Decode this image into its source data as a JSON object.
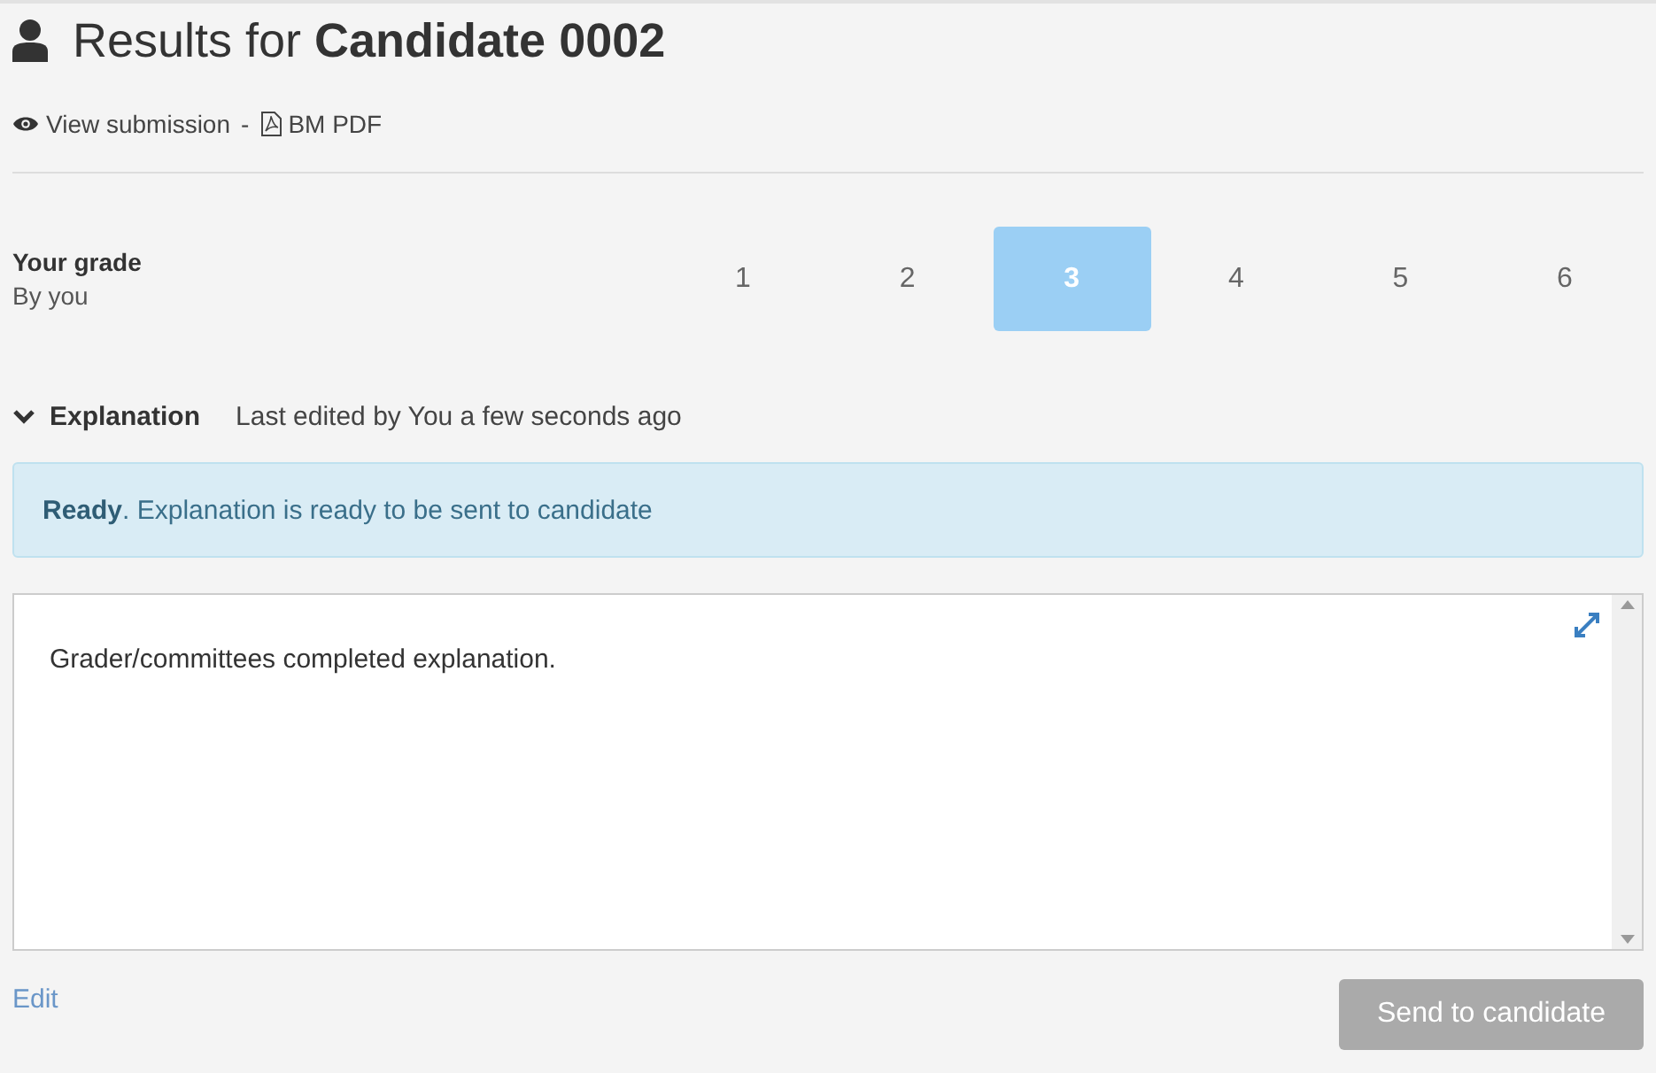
{
  "header": {
    "title": "Results for **Candidate 0002**"
  },
  "links": [
    {
      "label": "View submission",
      "kind": "view"
    },
    {
      "label": "-",
      "kind": "separator"
    },
    {
      "label": "BM PDF",
      "kind": "pdf"
    }
  ],
  "grade": {
    "label": "Your grade",
    "sublabel": "By you",
    "options": [
      {
        "label": "1",
        "selected": false
      },
      {
        "label": "2",
        "selected": false
      },
      {
        "label": "3",
        "selected": true
      },
      {
        "label": "4",
        "selected": false
      },
      {
        "label": "5",
        "selected": false
      },
      {
        "label": "6",
        "selected": false
      }
    ]
  },
  "explanation": {
    "title": "Explanation",
    "expanded": true,
    "meta": "Last edited by You a few seconds ago",
    "alert": "**Ready**. Explanation is ready to be sent to candidate",
    "text": "Grader/committees completed explanation."
  },
  "footer": {
    "edit": "Edit",
    "send": {
      "label": "Send to candidate",
      "disabled": true
    }
  }
}
